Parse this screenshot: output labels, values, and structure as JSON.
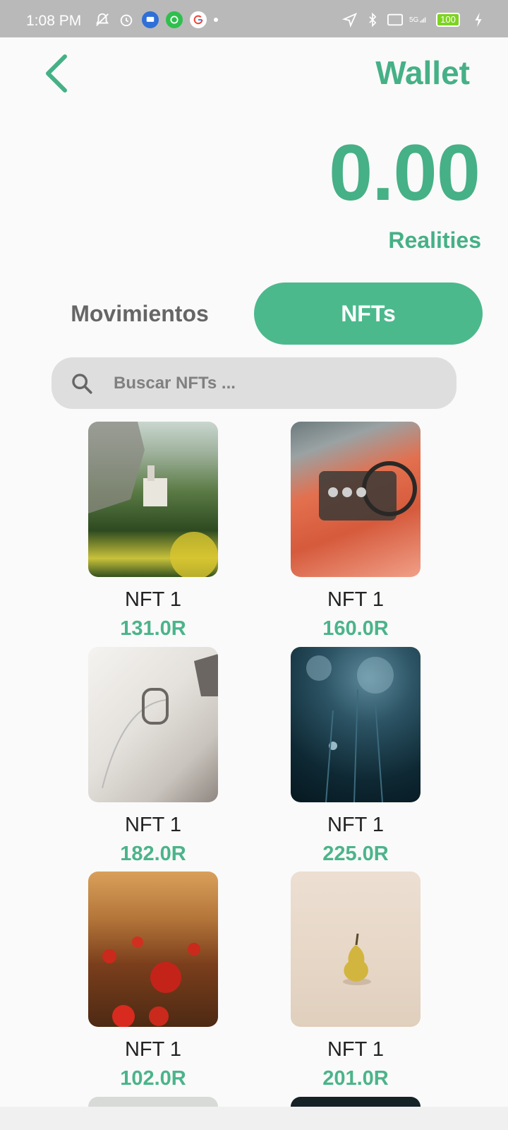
{
  "status_bar": {
    "time": "1:08 PM",
    "battery": "100",
    "network": "5G"
  },
  "header": {
    "title": "Wallet"
  },
  "wallet": {
    "balance": "0.00",
    "currency": "Realities"
  },
  "tabs": {
    "movements_label": "Movimientos",
    "nfts_label": "NFTs"
  },
  "search": {
    "placeholder": "Buscar NFTs ..."
  },
  "nfts": [
    {
      "name": "NFT 1",
      "price": "131.0R"
    },
    {
      "name": "NFT 1",
      "price": "160.0R"
    },
    {
      "name": "NFT 1",
      "price": "182.0R"
    },
    {
      "name": "NFT 1",
      "price": "225.0R"
    },
    {
      "name": "NFT 1",
      "price": "102.0R"
    },
    {
      "name": "NFT 1",
      "price": "201.0R"
    }
  ],
  "colors": {
    "accent": "#46b086",
    "tab_active": "#4cb98d"
  }
}
